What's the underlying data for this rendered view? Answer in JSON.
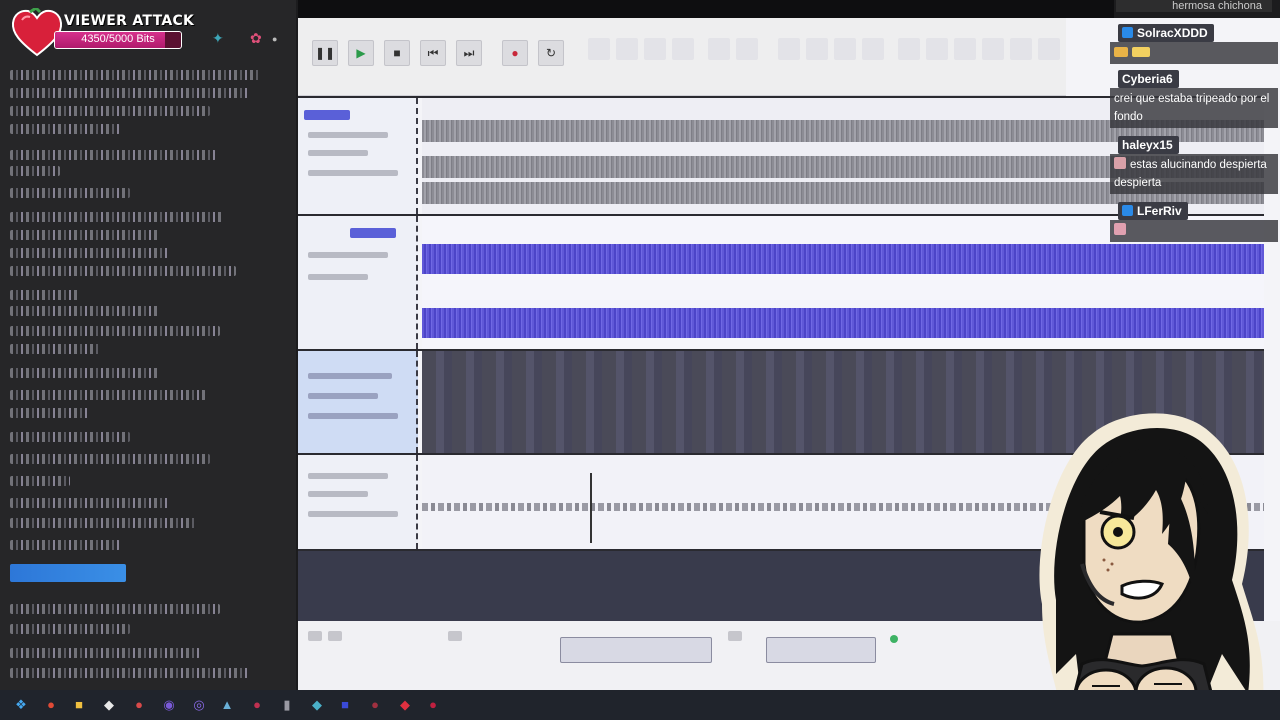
{
  "overlay": {
    "title": "VIEWER ATTACK",
    "bits_text": "4350/5000 Bits",
    "bits_progress": 0.87,
    "accent_color": "#d6318c"
  },
  "chat": {
    "previous_message": "hermosa chichona",
    "messages": [
      {
        "user": "SolracXDDD",
        "text": "",
        "badge_color": "#2a8ae8"
      },
      {
        "user": "Cyberia6",
        "text": "crei que estaba tripeado por el fondo",
        "badge_color": ""
      },
      {
        "user": "haleyx15",
        "text": "estas alucinando despierta despierta",
        "badge_color": ""
      },
      {
        "user": "LFerRiv",
        "text": "",
        "badge_color": "#2a8ae8"
      }
    ]
  },
  "editor": {
    "track_colors": [
      "#8c8c94",
      "#5a52d6",
      "#4a4a58",
      "#9a9aa4"
    ],
    "selection_color": "#3a8fe6",
    "status_color": "#3eb264"
  },
  "icons": [
    "heart-icon",
    "toolbar-tool-icon",
    "chat-badge-icon",
    "taskbar-app-icon"
  ]
}
